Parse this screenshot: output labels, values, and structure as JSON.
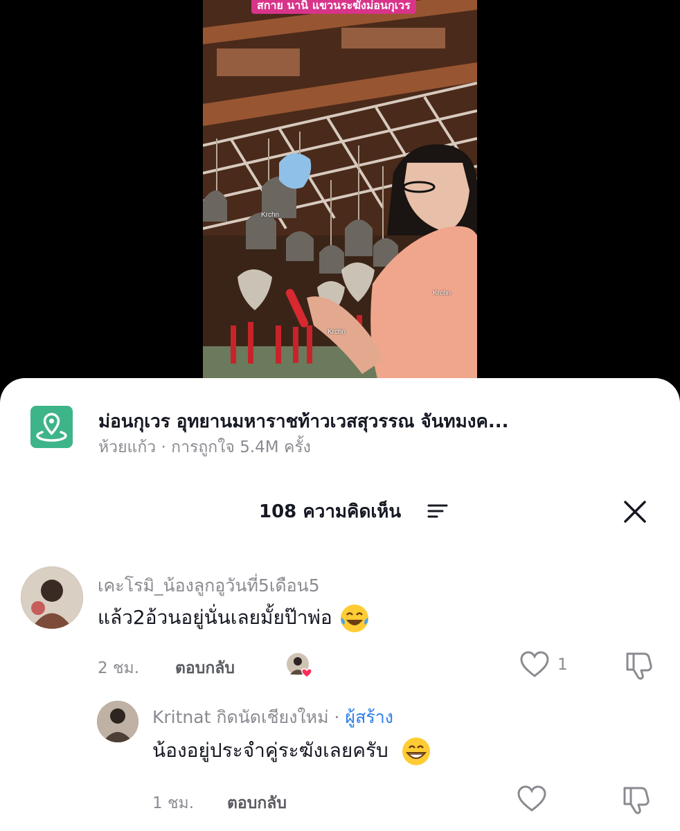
{
  "video": {
    "caption": "สกาย นานิ แขวนระฆังม่อนกุเวร",
    "watermarks": [
      "Krchn",
      "Krchn",
      "Krchn"
    ]
  },
  "location": {
    "icon": "location-pin-icon",
    "title": "ม่อนกุเวร อุทยานมหาราชท้าวเวสสุวรรณ จันทมงค...",
    "meta": "ห้วยแก้ว · การถูกใจ 5.4M ครั้ง"
  },
  "comments_header": {
    "count_label": "108 ความคิดเห็น"
  },
  "comments": [
    {
      "username": "เคะโรมิ_น้องลูกอูวันที่5เดือน5",
      "text": "แล้ว2อ้วนอยู่นั่นเลยมั้ยป๊าพ่อ",
      "emoji": "laughing-tears",
      "time": "2 ชม.",
      "reply_label": "ตอบกลับ",
      "like_count": "1"
    },
    {
      "username": "Kritnat กิดนัดเชียงใหม่",
      "separator": " · ",
      "creator_tag": "ผู้สร้าง",
      "text": "น้องอยู่ประจำคู่ระฆังเลยครับ",
      "emoji": "grinning",
      "time": "1 ชม.",
      "reply_label": "ตอบกลับ"
    }
  ],
  "colors": {
    "location_icon_bg": "#3eb489",
    "creator_tag": "#2b7de9",
    "secondary_text": "#8a8b91",
    "liked_heart": "#fe2c55"
  }
}
